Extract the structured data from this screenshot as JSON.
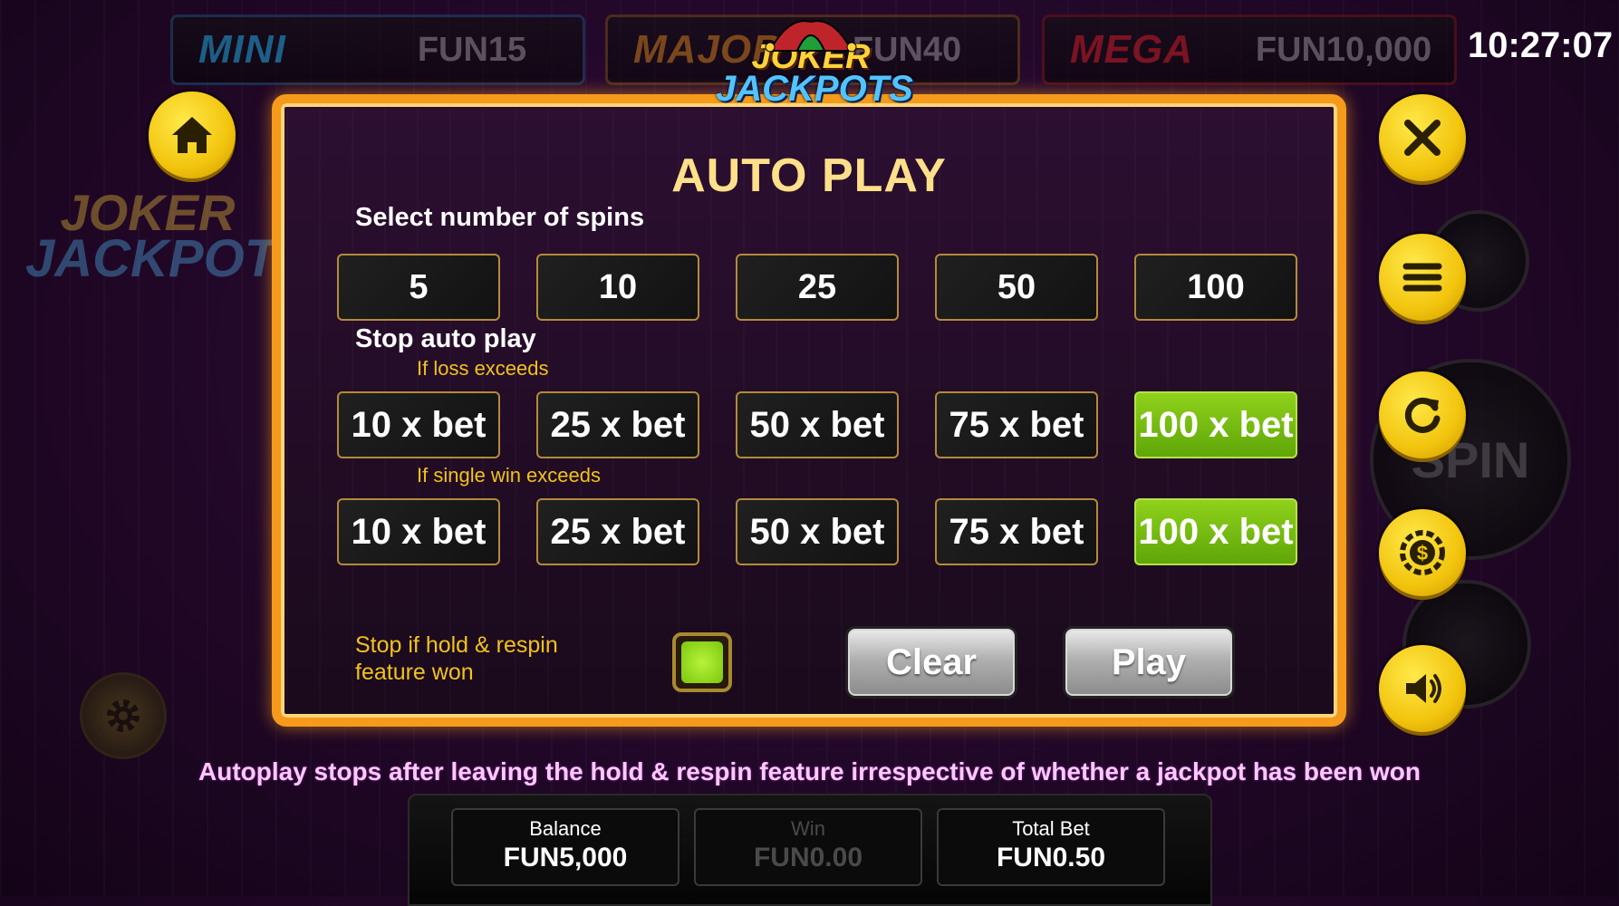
{
  "jackpots": {
    "mini": {
      "name": "MINI",
      "value": "FUN15"
    },
    "major": {
      "name": "MAJOR",
      "value": "FUN40"
    },
    "mega": {
      "name": "MEGA",
      "value": "FUN10,000"
    }
  },
  "clock": "10:27:07",
  "logo": {
    "line1": "JOKER",
    "line2": "JACKPOTS"
  },
  "dialog": {
    "title": "AUTO PLAY",
    "spins_label": "Select number of spins",
    "spins": [
      "5",
      "10",
      "25",
      "50",
      "100"
    ],
    "stop_label": "Stop auto play",
    "loss_label": "If loss exceeds",
    "loss_options": [
      "10 x bet",
      "25 x bet",
      "50 x bet",
      "75 x bet",
      "100 x bet"
    ],
    "loss_selected": "100 x bet",
    "win_label": "If single win exceeds",
    "win_options": [
      "10 x bet",
      "25 x bet",
      "50 x bet",
      "75 x bet",
      "100 x bet"
    ],
    "win_selected": "100 x bet",
    "feature_stop_label_1": "Stop if hold & respin",
    "feature_stop_label_2": "feature won",
    "feature_stop_checked": true,
    "clear_label": "Clear",
    "play_label": "Play"
  },
  "notice": "Autoplay stops after leaving the hold & respin feature irrespective of whether a jackpot has been won",
  "spin_label": "SPIN",
  "stats": {
    "balance_label": "Balance",
    "balance_value": "FUN5,000",
    "win_label": "Win",
    "win_value": "FUN0.00",
    "total_bet_label": "Total Bet",
    "total_bet_value": "FUN0.50"
  },
  "icons": {
    "home": "home-icon",
    "close": "close-icon",
    "menu": "menu-icon",
    "refresh": "refresh-icon",
    "coin": "coin-icon",
    "sound": "sound-icon",
    "settings": "gear-icon"
  },
  "colors": {
    "accent": "#f59a1b",
    "selected": "#7cc213",
    "button_yellow": "#f2c40d",
    "notice": "#ffc8ff"
  }
}
